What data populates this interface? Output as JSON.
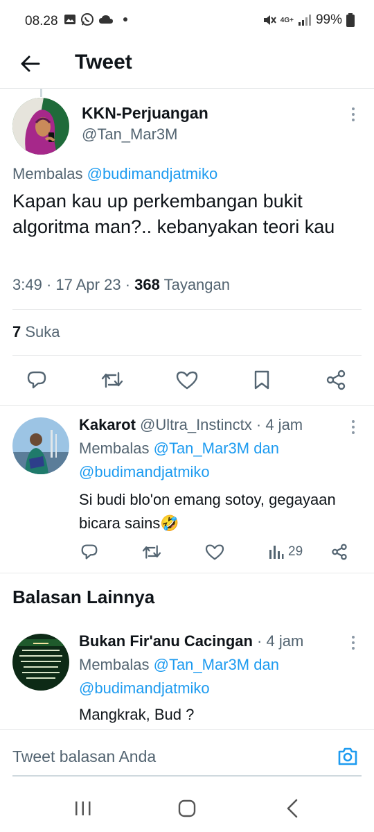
{
  "status_bar": {
    "time": "08.28",
    "network": "4G+",
    "battery": "99%"
  },
  "header": {
    "title": "Tweet"
  },
  "main_tweet": {
    "name": "KKN-Perjuangan",
    "handle": "@Tan_Mar3M",
    "reply_prefix": "Membalas",
    "reply_mention": "@budimandjatmiko",
    "text": "Kapan kau up perkembangan bukit algoritma man?.. kebanyakan teori kau",
    "time": "3:49",
    "date": "17 Apr 23",
    "views_count": "368",
    "views_label": "Tayangan",
    "likes_count": "7",
    "likes_label": "Suka"
  },
  "reply1": {
    "name": "Kakarot",
    "handle": "@Ultra_Instinctx",
    "age": "4 jam",
    "reply_prefix": "Membalas",
    "mention1": "@Tan_Mar3M",
    "connector": "dan",
    "mention2": "@budimandjatmiko",
    "text": "Si budi blo'on emang sotoy, gegayaan bicara sains🤣",
    "views": "29"
  },
  "more_replies": {
    "title": "Balasan Lainnya"
  },
  "reply2": {
    "name": "Bukan Fir'anu Cacingan",
    "age": "4 jam",
    "reply_prefix": "Membalas",
    "mention1": "@Tan_Mar3M",
    "connector": "dan",
    "mention2": "@budimandjatmiko",
    "text": "Mangkrak, Bud ?"
  },
  "compose": {
    "placeholder": "Tweet balasan Anda"
  },
  "colors": {
    "accent": "#1d9bf0",
    "text_secondary": "#536471",
    "divider": "#e7e9ea"
  },
  "icons": [
    "back-arrow-icon",
    "more-icon",
    "reply-icon",
    "retweet-icon",
    "like-icon",
    "bookmark-icon",
    "share-icon",
    "views-icon",
    "camera-icon",
    "recents-icon",
    "home-icon",
    "back-nav-icon"
  ]
}
